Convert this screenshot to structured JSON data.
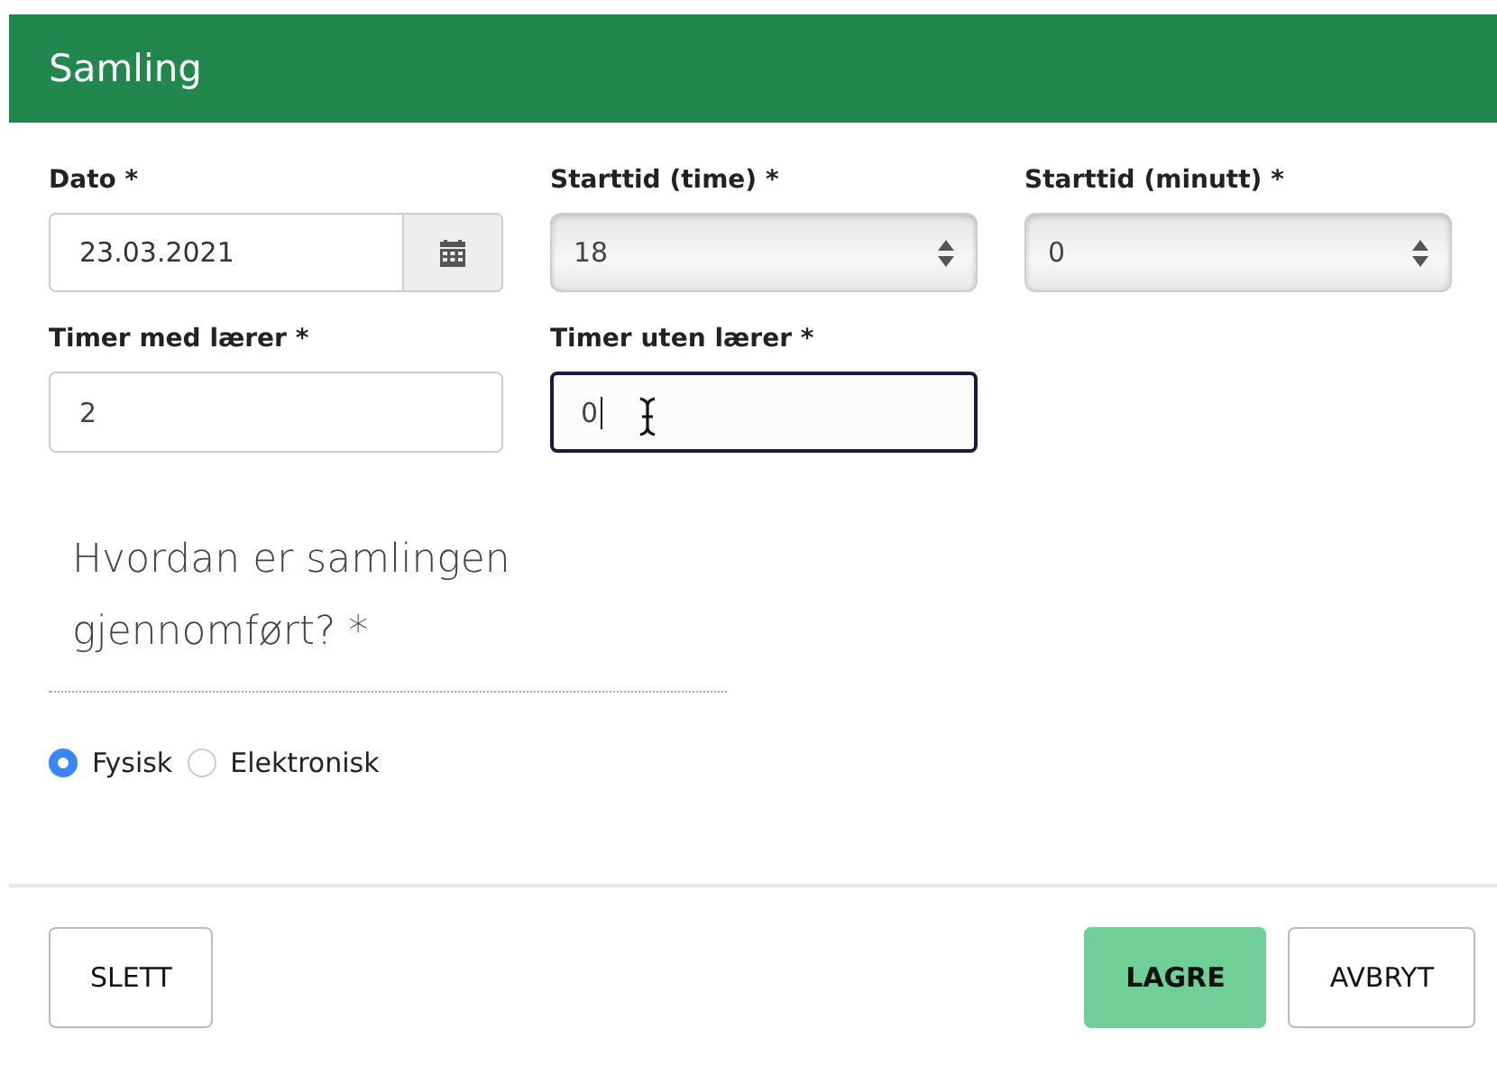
{
  "header": {
    "title": "Samling"
  },
  "fields": [
    {
      "label": "Dato *",
      "kind": "date",
      "value": "23.03.2021"
    },
    {
      "label": "Starttid (time) *",
      "kind": "select",
      "value": "18"
    },
    {
      "label": "Starttid (minutt) *",
      "kind": "select",
      "value": "0"
    },
    {
      "label": "Timer med lærer *",
      "kind": "text",
      "value": "2",
      "focused": false
    },
    {
      "label": "Timer uten lærer *",
      "kind": "text",
      "value": "0",
      "focused": true
    }
  ],
  "question": {
    "label": "Hvordan er samlingen gjennomført? *"
  },
  "options": [
    {
      "label": "Fysisk",
      "selected": true
    },
    {
      "label": "Elektronisk",
      "selected": false
    }
  ],
  "buttons": [
    {
      "label": "SLETT",
      "kind": "default"
    },
    {
      "label": "LAGRE",
      "kind": "primary"
    },
    {
      "label": "AVBRYT",
      "kind": "default"
    }
  ]
}
